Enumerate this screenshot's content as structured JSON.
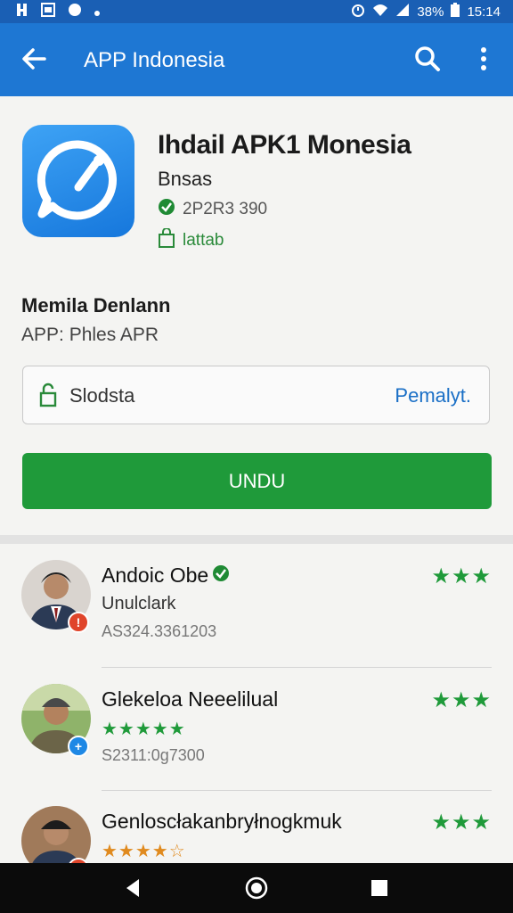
{
  "status_bar": {
    "left_icons": [
      "notification-icon",
      "sim-icon",
      "messenger-icon",
      "dot-icon"
    ],
    "battery": "38%",
    "time": "15:14"
  },
  "app_bar": {
    "title": "APP Indonesia"
  },
  "app": {
    "name": "Ihdail APK1 Monesia",
    "developer": "Bnsas",
    "meta": "2P2R3 390",
    "status": "lattab"
  },
  "section": {
    "title": "Memila Denlann",
    "subtitle": "APP: Phles APR"
  },
  "field": {
    "value": "Slodsta",
    "action": "Pemalyt."
  },
  "download_button": {
    "label": "UNDU"
  },
  "reviews": [
    {
      "name": "Andoic Obe",
      "line2": "Unulclark",
      "code": "AS324.3361203",
      "rating_right": "★★★",
      "badge_color": "#e0452b",
      "badge_glyph": "!",
      "line2_type": "text"
    },
    {
      "name": "Glekeloa Neeelilual",
      "line2": "★★★★★",
      "code": "S2311:0g7300",
      "rating_right": "★★★",
      "badge_color": "#1e88e5",
      "badge_glyph": "+",
      "line2_type": "stars",
      "line2_color": "#1f9a3a"
    },
    {
      "name": "Genloscłakanbryłnogkmuk",
      "line2": "★★★★☆",
      "code": "",
      "rating_right": "★★★",
      "badge_color": "#e0452b",
      "badge_glyph": "!",
      "line2_type": "stars",
      "line2_color": "#e08a1e"
    }
  ],
  "colors": {
    "app_bar": "#1e77d3",
    "accent_green": "#1f9a3a",
    "link_blue": "#1a6fc6"
  }
}
